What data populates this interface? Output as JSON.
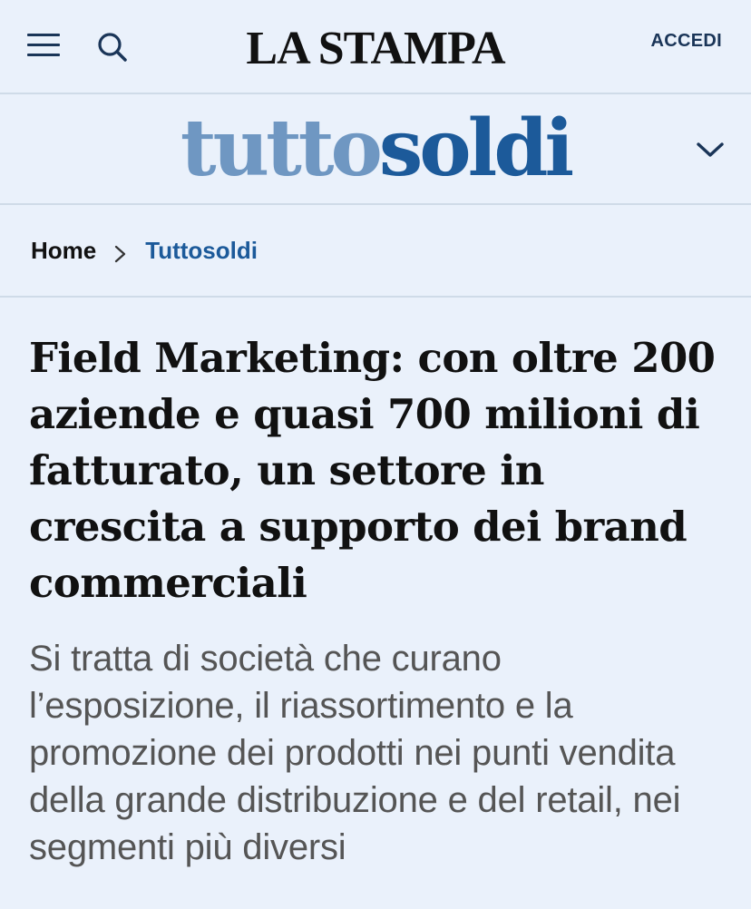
{
  "header": {
    "logo": "LA STAMPA",
    "login_label": "ACCEDI",
    "menu_icon": "hamburger-menu-icon",
    "search_icon": "search-icon"
  },
  "section": {
    "logo_part1": "tutto",
    "logo_part2": "soldi",
    "chevron_icon": "chevron-down-icon",
    "colors": {
      "part1": "#6f97c2",
      "part2": "#1c5a9a"
    }
  },
  "breadcrumb": {
    "home": "Home",
    "current": "Tuttosoldi",
    "separator_icon": "chevron-right-icon"
  },
  "article": {
    "headline": "Field Marketing: con oltre 200 aziende e quasi 700 milioni di fatturato, un settore in crescita a supporto dei brand commerciali",
    "subtitle": "Si tratta di società che curano l’esposizione, il riassortimento e la promozione dei prodotti nei punti vendita della grande distribuzione e del retail, nei segmenti più diversi"
  }
}
